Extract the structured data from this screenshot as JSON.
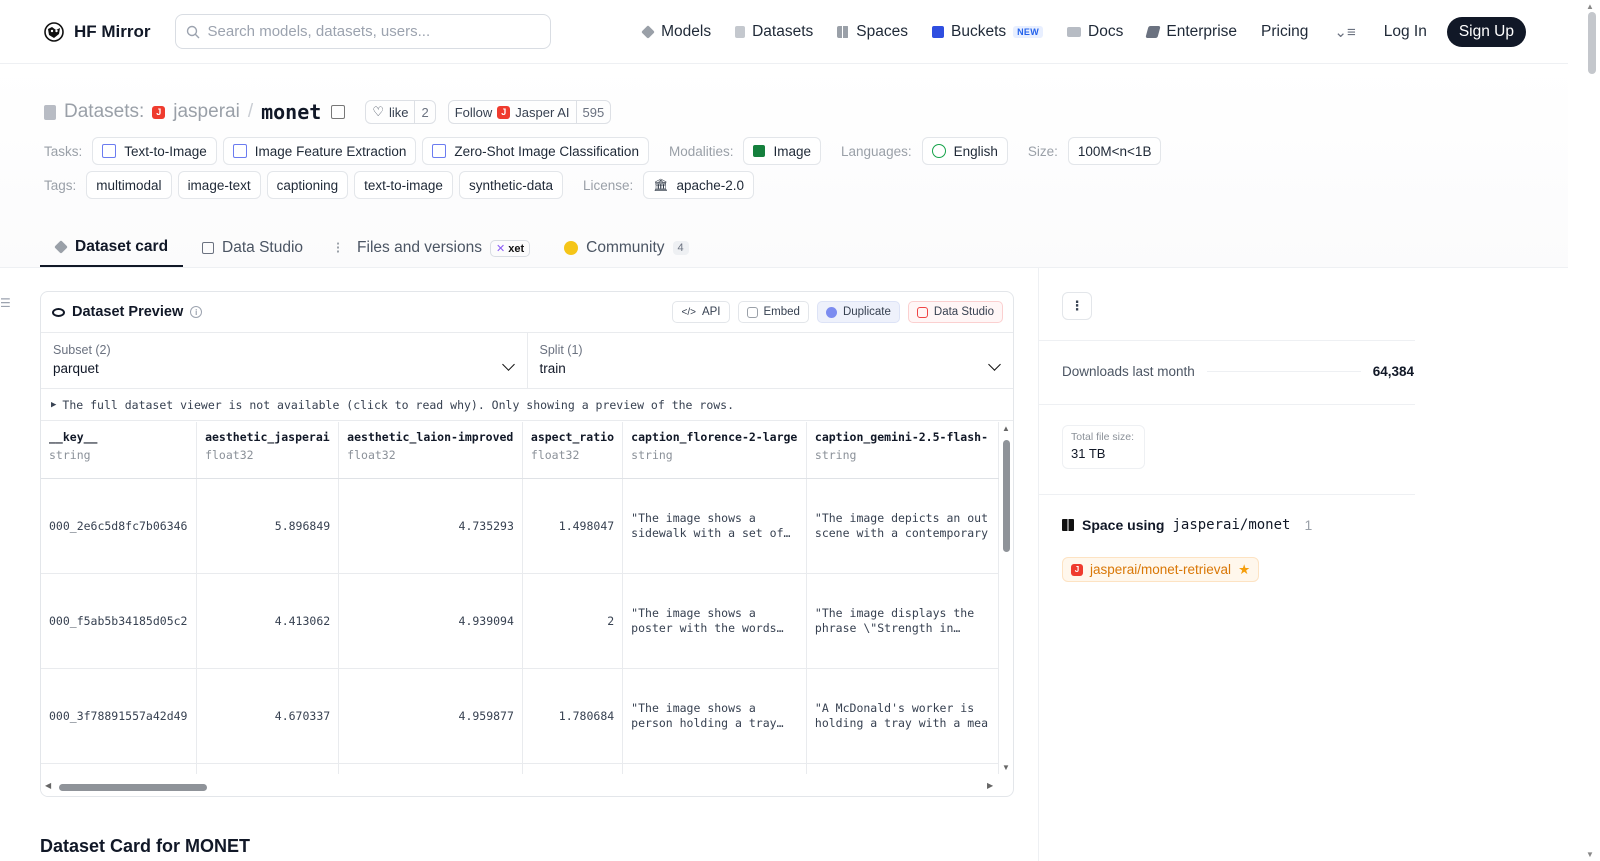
{
  "nav": {
    "brand": "HF Mirror",
    "search_placeholder": "Search models, datasets, users...",
    "links": [
      {
        "label": "Models",
        "color": "#9aa0a8"
      },
      {
        "label": "Datasets",
        "color": "#c4c8ce"
      },
      {
        "label": "Spaces",
        "color": "#9aa0a8"
      },
      {
        "label": "Buckets",
        "color": "#2f4ee0",
        "badge": "NEW"
      },
      {
        "label": "Docs",
        "color": "#b7bcc4"
      },
      {
        "label": "Enterprise",
        "color": "#6b7280"
      },
      {
        "label": "Pricing"
      }
    ],
    "login": "Log In",
    "signup": "Sign Up"
  },
  "header": {
    "section": "Datasets:",
    "org": "jasperai",
    "name": "monet",
    "like_label": "like",
    "like_count": "2",
    "follow_label": "Follow",
    "follow_org": "Jasper AI",
    "follow_count": "595",
    "tasks_label": "Tasks:",
    "tasks": [
      "Text-to-Image",
      "Image Feature Extraction",
      "Zero-Shot Image Classification"
    ],
    "modalities_label": "Modalities:",
    "modality": "Image",
    "languages_label": "Languages:",
    "language": "English",
    "size_label": "Size:",
    "size": "100M<n<1B",
    "tags_label": "Tags:",
    "tags": [
      "multimodal",
      "image-text",
      "captioning",
      "text-to-image",
      "synthetic-data"
    ],
    "license_label": "License:",
    "license": "apache-2.0"
  },
  "tabs": [
    {
      "label": "Dataset card"
    },
    {
      "label": "Data Studio"
    },
    {
      "label": "Files and versions",
      "badge": "xet"
    },
    {
      "label": "Community",
      "count": "4"
    }
  ],
  "preview": {
    "title": "Dataset Preview",
    "actions": [
      "API",
      "Embed",
      "Duplicate",
      "Data Studio"
    ],
    "subset_label": "Subset (2)",
    "subset_value": "parquet",
    "split_label": "Split (1)",
    "split_value": "train",
    "notice": "The full dataset viewer is not available (click to read why). Only showing a preview of the rows.",
    "columns": [
      {
        "name": "__key__",
        "type": "string"
      },
      {
        "name": "aesthetic_jasperai",
        "type": "float32"
      },
      {
        "name": "aesthetic_laion-improved",
        "type": "float32"
      },
      {
        "name": "aspect_ratio",
        "type": "float32"
      },
      {
        "name": "caption_florence-2-large",
        "type": "string"
      },
      {
        "name": "caption_gemini-2.5-flash-",
        "type": "string"
      }
    ],
    "rows": [
      [
        "000_2e6c5d8fc7b06346",
        "5.896849",
        "4.735293",
        "1.498047",
        "\"The image shows a sidewalk with a set of…",
        "\"The image depicts an out scene with a contemporary"
      ],
      [
        "000_f5ab5b34185d05c2",
        "4.413062",
        "4.939094",
        "2",
        "\"The image shows a poster with the words…",
        "\"The image displays the phrase \\\"Strength in…"
      ],
      [
        "000_3f78891557a42d49",
        "4.670337",
        "4.959877",
        "1.780684",
        "\"The image shows a person holding a tray…",
        "\"A McDonald's worker is holding a tray with a mea"
      ],
      [
        "",
        "",
        "",
        "",
        "",
        ""
      ]
    ]
  },
  "sidebar": {
    "downloads_label": "Downloads last month",
    "downloads_value": "64,384",
    "filesize_label": "Total file size:",
    "filesize_value": "31 TB",
    "space_using_label": "Space using",
    "space_using_repo": "jasperai/monet",
    "space_using_count": "1",
    "space_chip": "jasperai/monet-retrieval"
  },
  "card_title": "Dataset Card for MONET"
}
